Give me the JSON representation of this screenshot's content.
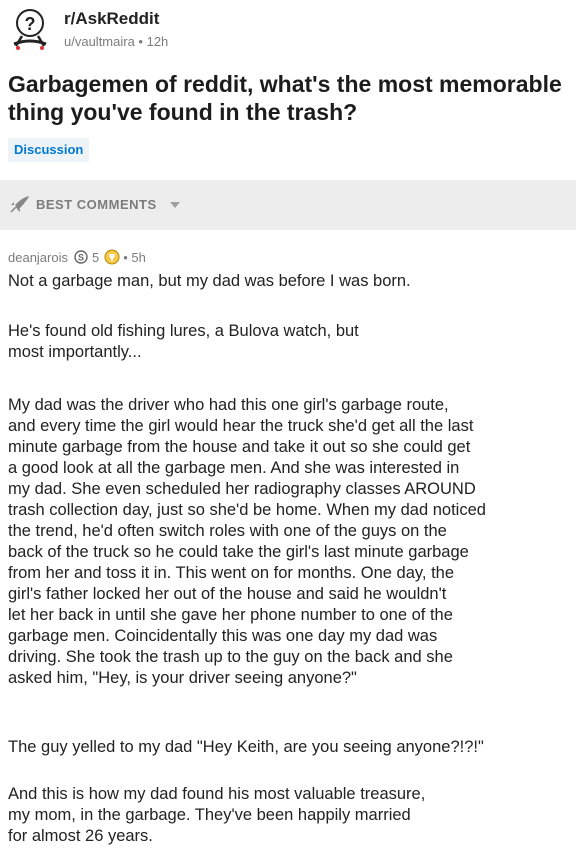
{
  "post": {
    "subreddit": "r/AskReddit",
    "author_meta": "u/vaultmaira • 12h",
    "title": "Garbagemen of reddit, what's the most memorable thing you've found in the trash?",
    "flair": "Discussion",
    "avatar_icon": "askreddit-snoo-icon"
  },
  "sort": {
    "label": "BEST COMMENTS",
    "icon": "rocket-icon"
  },
  "comment": {
    "author": "deanjarois",
    "score": "5",
    "age": "• 5h",
    "paragraphs": [
      "Not a garbage man, but my dad was before I was born.",
      "He's found old fishing lures, a Bulova watch, but\nmost importantly...",
      "My dad was the driver who had this one girl's garbage route,\nand every time the girl would hear the truck she'd get all the last\nminute garbage from the house and take it out so she could get\na good look at all the garbage men. And she was interested in\nmy dad. She even scheduled her radiography classes AROUND\ntrash collection day, just so she'd be home. When my dad noticed\nthe trend, he'd often switch roles with one of the guys on the\nback of the truck so he could take the girl's last minute garbage\nfrom her and toss it in. This went on for months. One day, the\ngirl's father locked her out of the house and said he wouldn't\nlet her back in until she gave her phone number to one of the\ngarbage men. Coincidentally this was one day my dad was\ndriving. She took the trash up to the guy on the back and she\nasked him, \"Hey, is your driver seeing anyone?\"",
      "The guy yelled to my dad \"Hey Keith, are you seeing anyone?!?!\"",
      "And this is how my dad found his most valuable treasure,\nmy mom, in the garbage. They've been happily married\nfor almost 26 years."
    ]
  }
}
